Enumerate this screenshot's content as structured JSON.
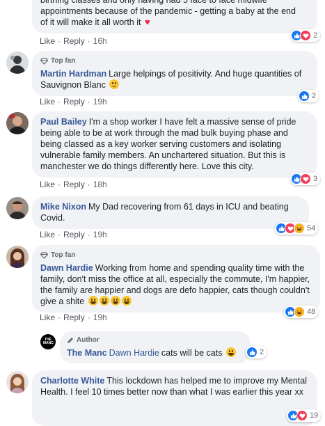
{
  "colors": {
    "name": "#385898",
    "bubble": "#f0f2f5",
    "meta": "#65676b",
    "like": "#1877f2",
    "love": "#f33e58",
    "haha": "#f7b125"
  },
  "actions": {
    "like": "Like",
    "reply": "Reply",
    "separator": "·"
  },
  "comments": [
    {
      "text_line1": "birthing classes and only having had 5 face to face midwife",
      "text_line2": "appointments because of the pandemic - getting a baby at the end",
      "text_line3": "of it will make it all worth it",
      "time": "16h",
      "reaction_count": "2",
      "reactions": [
        "like",
        "love"
      ]
    },
    {
      "badge": "Top fan",
      "name": "Martin Hardman",
      "text": "Large helpings of positivity. And huge quantities of Sauvignon Blanc",
      "time": "19h",
      "reaction_count": "2",
      "reactions": [
        "like"
      ]
    },
    {
      "name": "Paul Bailey",
      "text": "I'm a shop worker I have felt a massive sense of pride being able to be at work through the mad bulk buying phase and being classed as a key worker serving customers and isolating vulnerable family members. An unchartered situation. But this is manchester we do things differently here. Love this city.",
      "time": "18h",
      "reaction_count": "3",
      "reactions": [
        "like",
        "love"
      ]
    },
    {
      "name": "Mike Nixon",
      "text": "My Dad recovering from 61 days in ICU and beating Covid.",
      "time": "19h",
      "reaction_count": "54",
      "reactions": [
        "like",
        "love",
        "haha"
      ]
    },
    {
      "badge": "Top fan",
      "name": "Dawn Hardie",
      "text": "Working from home and spending quality time with the family, don't miss the office at all, especially the commute, I'm happier, the family are happier and dogs are defo happier, cats though couldn't give a shite",
      "time": "19h",
      "reaction_count": "48",
      "reactions": [
        "like",
        "haha"
      ]
    },
    {
      "badge": "Author",
      "name": "The Manc",
      "avatar_text": "THE MANC",
      "mention": "Dawn Hardie",
      "text": "cats will be cats",
      "reaction_count": "2",
      "reactions": [
        "like"
      ]
    },
    {
      "name": "Charlotte White",
      "text": "This lockdown has helped me to improve my Mental Health. I feel 10 times better now than what I was earlier this year xx",
      "reaction_count": "19",
      "reactions": [
        "like",
        "love"
      ]
    }
  ]
}
